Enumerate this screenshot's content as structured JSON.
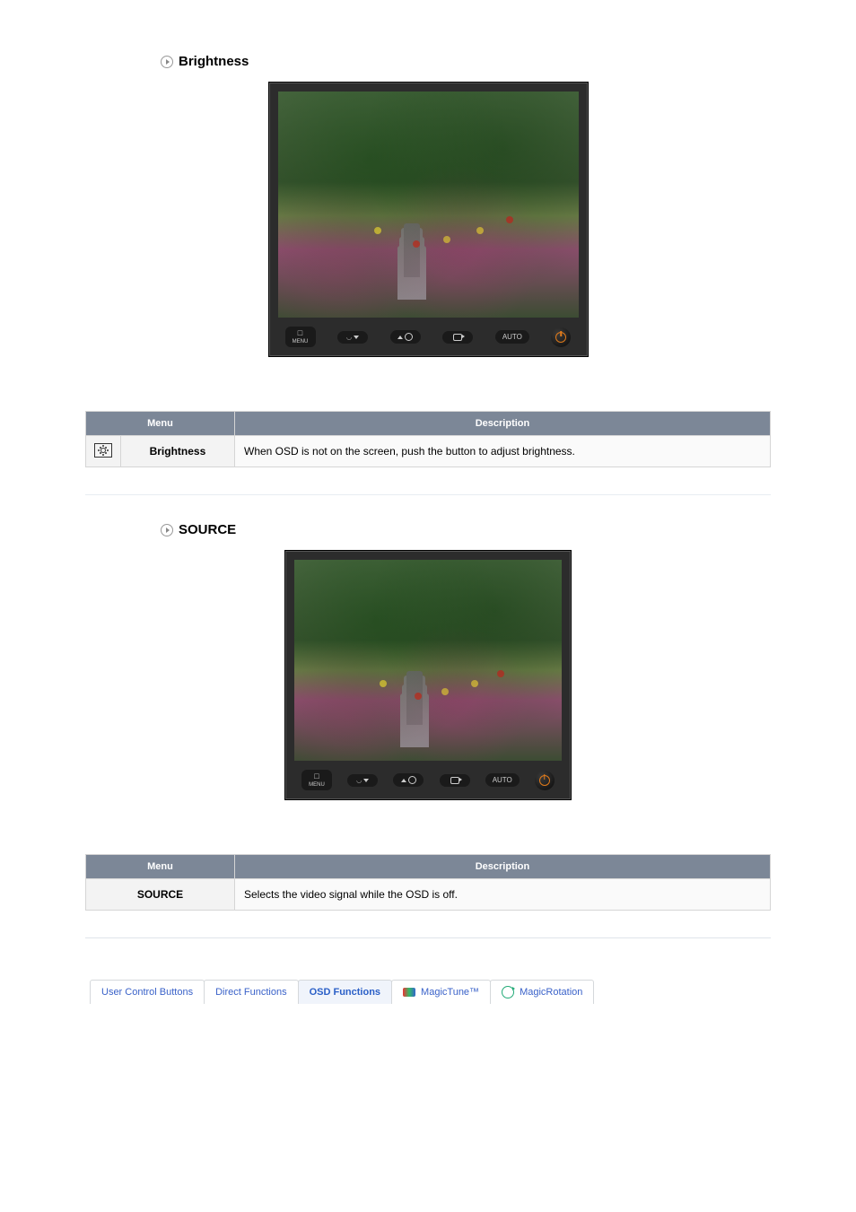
{
  "sections": {
    "brightness": {
      "title": "Brightness",
      "buttons": {
        "menu_top": "□",
        "menu_bottom": "MENU",
        "auto": "AUTO"
      },
      "table": {
        "headers": {
          "menu": "Menu",
          "description": "Description"
        },
        "rows": [
          {
            "label": "Brightness",
            "desc": "When OSD is not on the screen, push the button to adjust brightness."
          }
        ]
      }
    },
    "source": {
      "title": "SOURCE",
      "buttons": {
        "menu_top": "□",
        "menu_bottom": "MENU",
        "auto": "AUTO"
      },
      "table": {
        "headers": {
          "menu": "Menu",
          "description": "Description"
        },
        "rows": [
          {
            "label": "SOURCE",
            "desc": "Selects the video signal while the OSD is off."
          }
        ]
      }
    }
  },
  "bottom_nav": {
    "user_control": "User Control Buttons",
    "direct_functions": "Direct Functions",
    "osd_functions": "OSD Functions",
    "magictune": "MagicTune™",
    "magicrotation": "MagicRotation"
  }
}
